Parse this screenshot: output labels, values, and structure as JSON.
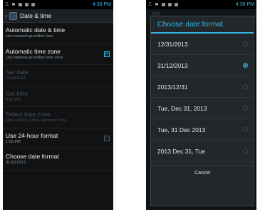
{
  "statusbar": {
    "time": "4:36 PM"
  },
  "left": {
    "title": "Date & time",
    "settings": [
      {
        "title": "Automatic date & time",
        "summary": "Use network-provided time"
      },
      {
        "title": "Automatic time zone",
        "summary": "Use network-provided time zone"
      },
      {
        "title": "Set date",
        "summary": "22/08/2013"
      },
      {
        "title": "Set time",
        "summary": "4:36 PM"
      },
      {
        "title": "Select time zone",
        "summary": "GMT+08:00, China Standard Time"
      },
      {
        "title": "Use 24-hour format",
        "summary": "1:00 PM"
      },
      {
        "title": "Choose date format",
        "summary": "31/12/2013"
      }
    ]
  },
  "dialog": {
    "title": "Choose date format",
    "options": [
      "12/31/2013",
      "31/12/2013",
      "2013/12/31",
      "Tue, Dec 31, 2013",
      "Tue, 31 Dec 2013",
      "2013 Dec 31, Tue"
    ],
    "selected": "31/12/2013",
    "cancel": "Cancel"
  },
  "colors": {
    "accent": "#33b5e5",
    "background": "#101214",
    "dialog": "#22272b"
  }
}
